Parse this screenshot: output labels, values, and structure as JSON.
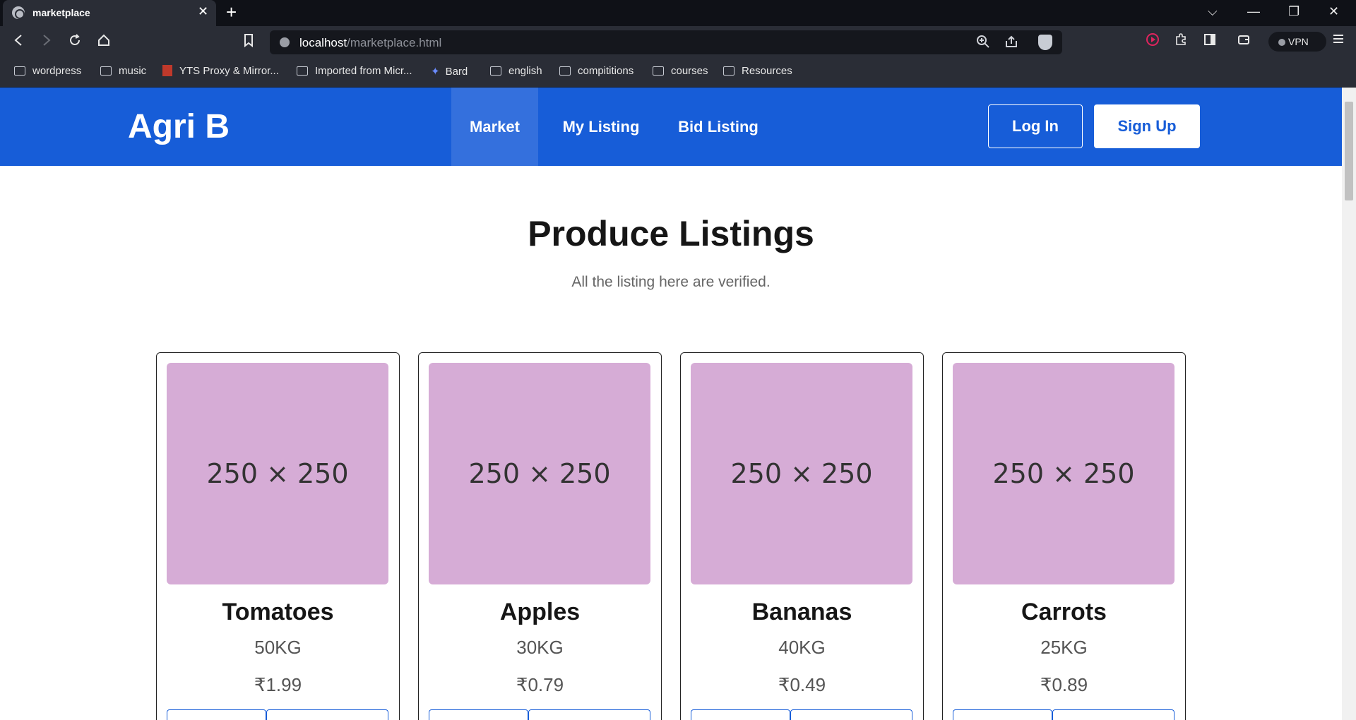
{
  "browser": {
    "tab_title": "marketplace",
    "tab_close_glyph": "✕",
    "new_tab_glyph": "+",
    "window_controls": [
      "⌵",
      "—",
      "❐",
      "✕"
    ],
    "url_host": "localhost",
    "url_path": "/marketplace.html",
    "vpn_label": "VPN",
    "bookmarks": [
      {
        "label": "wordpress",
        "icon": "folder-icon"
      },
      {
        "label": "music",
        "icon": "folder-icon"
      },
      {
        "label": "YTS Proxy & Mirror...",
        "icon": "yts-icon"
      },
      {
        "label": "Imported from Micr...",
        "icon": "folder-icon"
      },
      {
        "label": "Bard",
        "icon": "bard-icon"
      },
      {
        "label": "english",
        "icon": "folder-icon"
      },
      {
        "label": "compititions",
        "icon": "folder-icon"
      },
      {
        "label": "courses",
        "icon": "folder-icon"
      },
      {
        "label": "Resources",
        "icon": "folder-icon"
      }
    ]
  },
  "site": {
    "brand": "Agri B",
    "nav": [
      {
        "label": "Market",
        "active": true
      },
      {
        "label": "My Listing",
        "active": false
      },
      {
        "label": "Bid Listing",
        "active": false
      }
    ],
    "login_label": "Log In",
    "signup_label": "Sign Up",
    "accent_color": "#175dd8"
  },
  "main": {
    "title": "Produce Listings",
    "subtitle": "All the listing here are verified.",
    "products": [
      {
        "image_label": "250 × 250",
        "name": "Tomatoes",
        "quantity": "50KG",
        "price": "₹1.99"
      },
      {
        "image_label": "250 × 250",
        "name": "Apples",
        "quantity": "30KG",
        "price": "₹0.79"
      },
      {
        "image_label": "250 × 250",
        "name": "Bananas",
        "quantity": "40KG",
        "price": "₹0.49"
      },
      {
        "image_label": "250 × 250",
        "name": "Carrots",
        "quantity": "25KG",
        "price": "₹0.89"
      }
    ]
  }
}
